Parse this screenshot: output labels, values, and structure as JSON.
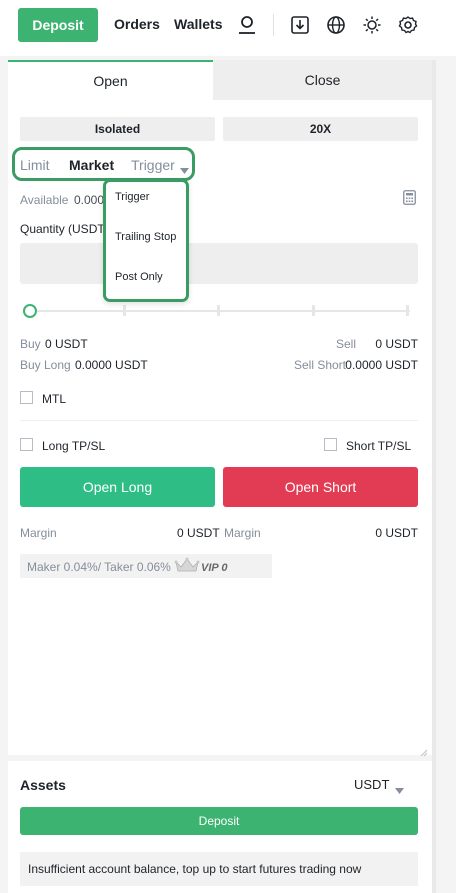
{
  "header": {
    "deposit_label": "Deposit",
    "orders_label": "Orders",
    "wallets_label": "Wallets",
    "icons": [
      "user-icon",
      "download-icon",
      "globe-icon",
      "theme-sun-icon",
      "settings-gear-icon"
    ]
  },
  "tabs": {
    "open": "Open",
    "close": "Close"
  },
  "margin_mode": {
    "mode": "Isolated",
    "leverage": "20X"
  },
  "order_types": {
    "limit": "Limit",
    "market": "Market",
    "trigger": "Trigger",
    "selected": "Market"
  },
  "dropdown": {
    "items": [
      "Trigger",
      "Trailing Stop",
      "Post Only"
    ]
  },
  "form": {
    "available_label": "Available",
    "available_value": "0.000",
    "quantity_label": "Quantity (USDT",
    "quantity_value": ""
  },
  "slider": {
    "percent": 0
  },
  "summary": {
    "buy_label": "Buy",
    "buy_value": "0 USDT",
    "sell_label": "Sell",
    "sell_value": "0 USDT",
    "buy_long_label": "Buy Long",
    "buy_long_value": "0.0000 USDT",
    "sell_short_label": "Sell Short",
    "sell_short_value": "0.0000 USDT"
  },
  "options": {
    "mtl": "MTL",
    "long_tpsl": "Long TP/SL",
    "short_tpsl": "Short TP/SL"
  },
  "actions": {
    "open_long": "Open Long",
    "open_short": "Open Short"
  },
  "margin": {
    "left_label": "Margin",
    "left_value": "0 USDT",
    "right_label": "Margin",
    "right_value": "0 USDT"
  },
  "fees": {
    "text": "Maker 0.04%/ Taker 0.06%",
    "vip": "VIP 0"
  },
  "assets": {
    "title": "Assets",
    "currency": "USDT",
    "deposit_label": "Deposit",
    "notice": "Insufficient account balance, top up to start futures trading now"
  },
  "colors": {
    "accent": "#3cb371",
    "long": "#2ebd85",
    "short": "#e23c55",
    "highlight": "#3a9c63"
  }
}
